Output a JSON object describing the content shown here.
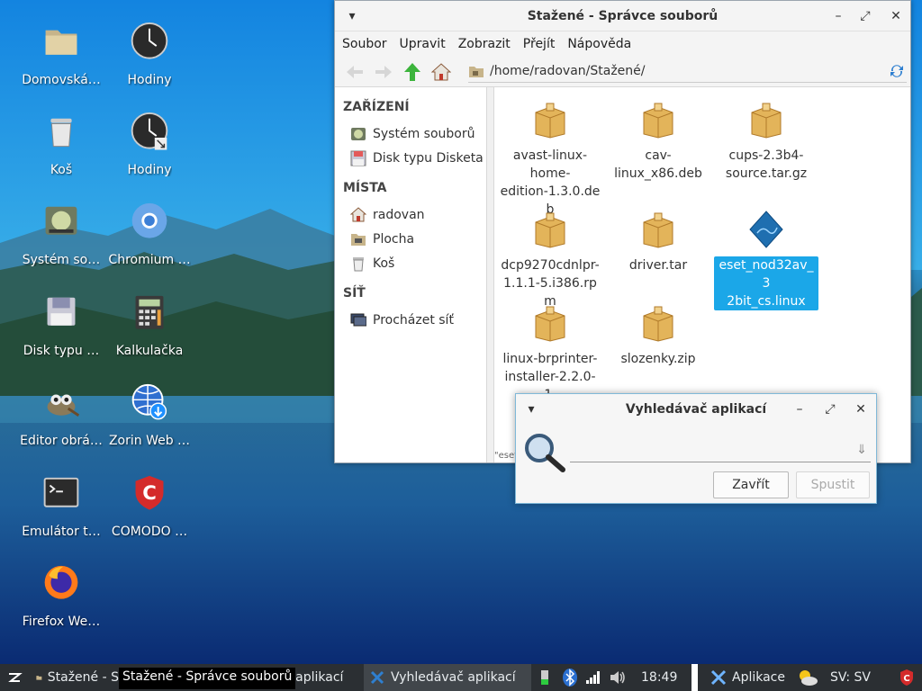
{
  "desktop": {
    "icons": [
      {
        "label": "Domovská…",
        "icon": "folder-icon"
      },
      {
        "label": "Hodiny",
        "icon": "clock-icon"
      },
      {
        "label": "Koš",
        "icon": "trash-icon"
      },
      {
        "label": "Hodiny",
        "icon": "clock-link-icon"
      },
      {
        "label": "Systém so…",
        "icon": "filesystem-icon"
      },
      {
        "label": "Chromium …",
        "icon": "chromium-icon"
      },
      {
        "label": "Disk typu …",
        "icon": "floppy-icon"
      },
      {
        "label": "Kalkulačka",
        "icon": "calculator-icon"
      },
      {
        "label": "Editor obrá…",
        "icon": "gimp-icon"
      },
      {
        "label": "Zorin Web …",
        "icon": "zorin-web-icon"
      },
      {
        "label": "Emulátor t…",
        "icon": "terminal-icon"
      },
      {
        "label": "COMODO …",
        "icon": "comodo-icon"
      },
      {
        "label": "Firefox We…",
        "icon": "firefox-icon"
      }
    ]
  },
  "file_manager": {
    "title": "Stažené - Správce souborů",
    "menu": [
      "Soubor",
      "Upravit",
      "Zobrazit",
      "Přejít",
      "Nápověda"
    ],
    "path": "/home/radovan/Stažené/",
    "sidebar": {
      "sections": [
        {
          "heading": "ZAŘÍZENÍ",
          "items": [
            {
              "label": "Systém souborů",
              "icon": "filesystem-icon"
            },
            {
              "label": "Disk typu Disketa",
              "icon": "floppy-icon"
            }
          ]
        },
        {
          "heading": "MÍSTA",
          "items": [
            {
              "label": "radovan",
              "icon": "home-icon"
            },
            {
              "label": "Plocha",
              "icon": "desktop-icon"
            },
            {
              "label": "Koš",
              "icon": "trash-icon"
            }
          ]
        },
        {
          "heading": "SÍŤ",
          "items": [
            {
              "label": "Procházet síť",
              "icon": "network-icon"
            }
          ]
        }
      ]
    },
    "files": [
      {
        "name": "avast-linux-home-edition-1.3.0.deb",
        "icon": "package-icon",
        "selected": false
      },
      {
        "name": "cav-linux_x86.deb",
        "icon": "package-icon",
        "selected": false
      },
      {
        "name": "cups-2.3b4-source.tar.gz",
        "icon": "package-icon",
        "selected": false
      },
      {
        "name": "dcp9270cdnlpr-1.1.1-5.i386.rpm",
        "icon": "package-icon",
        "selected": false
      },
      {
        "name": "driver.tar",
        "icon": "package-icon",
        "selected": false
      },
      {
        "name": "eset_nod32av_32bit_cs.linux",
        "icon": "eset-icon",
        "selected": true
      },
      {
        "name": "linux-brprinter-installer-2.2.0-1.",
        "icon": "package-icon",
        "selected": false
      },
      {
        "name": "slozenky.zip",
        "icon": "package-icon",
        "selected": false
      }
    ],
    "display_names": [
      [
        "avast-linux-",
        "home-",
        "edition-1.3.0.deb"
      ],
      [
        "cav-",
        "linux_x86.deb"
      ],
      [
        "cups-2.3b4-",
        "source.tar.gz"
      ],
      [
        "dcp9270cdnlpr-",
        "1.1.1-5.i386.rpm"
      ],
      [
        "driver.tar"
      ],
      [
        "eset_nod32av_3",
        "2bit_cs.linux"
      ],
      [
        "linux-brprinter-",
        "installer-2.2.0-1."
      ],
      [
        "slozenky.zip"
      ]
    ],
    "status_text": "\"eset"
  },
  "app_finder": {
    "title": "Vyhledávač aplikací",
    "input_value": "",
    "close_label": "Zavřít",
    "run_label": "Spustit"
  },
  "taskbar": {
    "tasks": [
      {
        "label": "Stažené - S"
      },
      {
        "label": "č aplikací"
      },
      {
        "label": "Vyhledávač aplikací"
      }
    ],
    "tooltip": "Stažené - Správce souborů",
    "clock": "18:49",
    "apps_label": "Aplikace",
    "keyboard": "SV: SV"
  }
}
